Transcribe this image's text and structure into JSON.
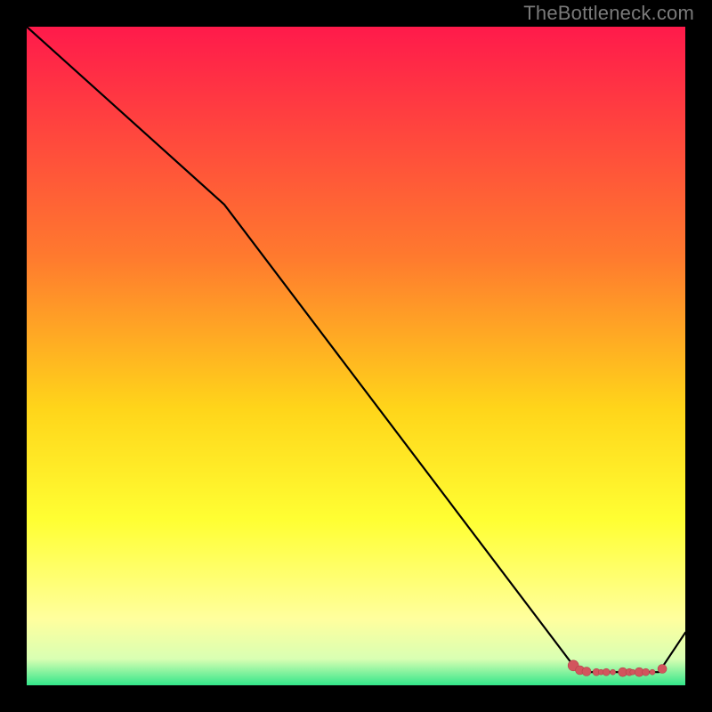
{
  "attribution": "TheBottleneck.com",
  "colors": {
    "gradient_top": "#ff1a4b",
    "gradient_mid1": "#ff7a2e",
    "gradient_mid2": "#ffd51a",
    "gradient_mid3": "#ffff33",
    "gradient_mid4": "#ffff9e",
    "gradient_bot1": "#d9ffb3",
    "gradient_bot2": "#33e68a",
    "line": "#000000",
    "marker_fill": "#d2555d",
    "marker_stroke": "#b54049"
  },
  "chart_data": {
    "type": "line",
    "title": "",
    "xlabel": "",
    "ylabel": "",
    "xlim": [
      0,
      100
    ],
    "ylim": [
      0,
      100
    ],
    "series": [
      {
        "name": "curve",
        "x": [
          0,
          30,
          83,
          85,
          86,
          87,
          88,
          89,
          90,
          91,
          92,
          93,
          94,
          95,
          96,
          100
        ],
        "y": [
          100,
          73,
          3,
          2,
          2,
          2,
          2,
          2,
          2,
          2,
          2,
          2,
          2,
          2,
          2,
          8
        ]
      }
    ],
    "markers": [
      {
        "x": 83.0,
        "y": 3.0,
        "r": 6
      },
      {
        "x": 84.0,
        "y": 2.3,
        "r": 5
      },
      {
        "x": 85.0,
        "y": 2.1,
        "r": 5
      },
      {
        "x": 86.5,
        "y": 2.0,
        "r": 4
      },
      {
        "x": 87.2,
        "y": 2.0,
        "r": 3
      },
      {
        "x": 88.0,
        "y": 2.0,
        "r": 4
      },
      {
        "x": 89.0,
        "y": 2.0,
        "r": 3
      },
      {
        "x": 90.5,
        "y": 2.0,
        "r": 5
      },
      {
        "x": 91.5,
        "y": 2.0,
        "r": 4
      },
      {
        "x": 92.0,
        "y": 2.0,
        "r": 3
      },
      {
        "x": 93.0,
        "y": 2.0,
        "r": 5
      },
      {
        "x": 94.0,
        "y": 2.0,
        "r": 4
      },
      {
        "x": 95.0,
        "y": 2.0,
        "r": 3
      },
      {
        "x": 96.5,
        "y": 2.5,
        "r": 5
      }
    ]
  }
}
